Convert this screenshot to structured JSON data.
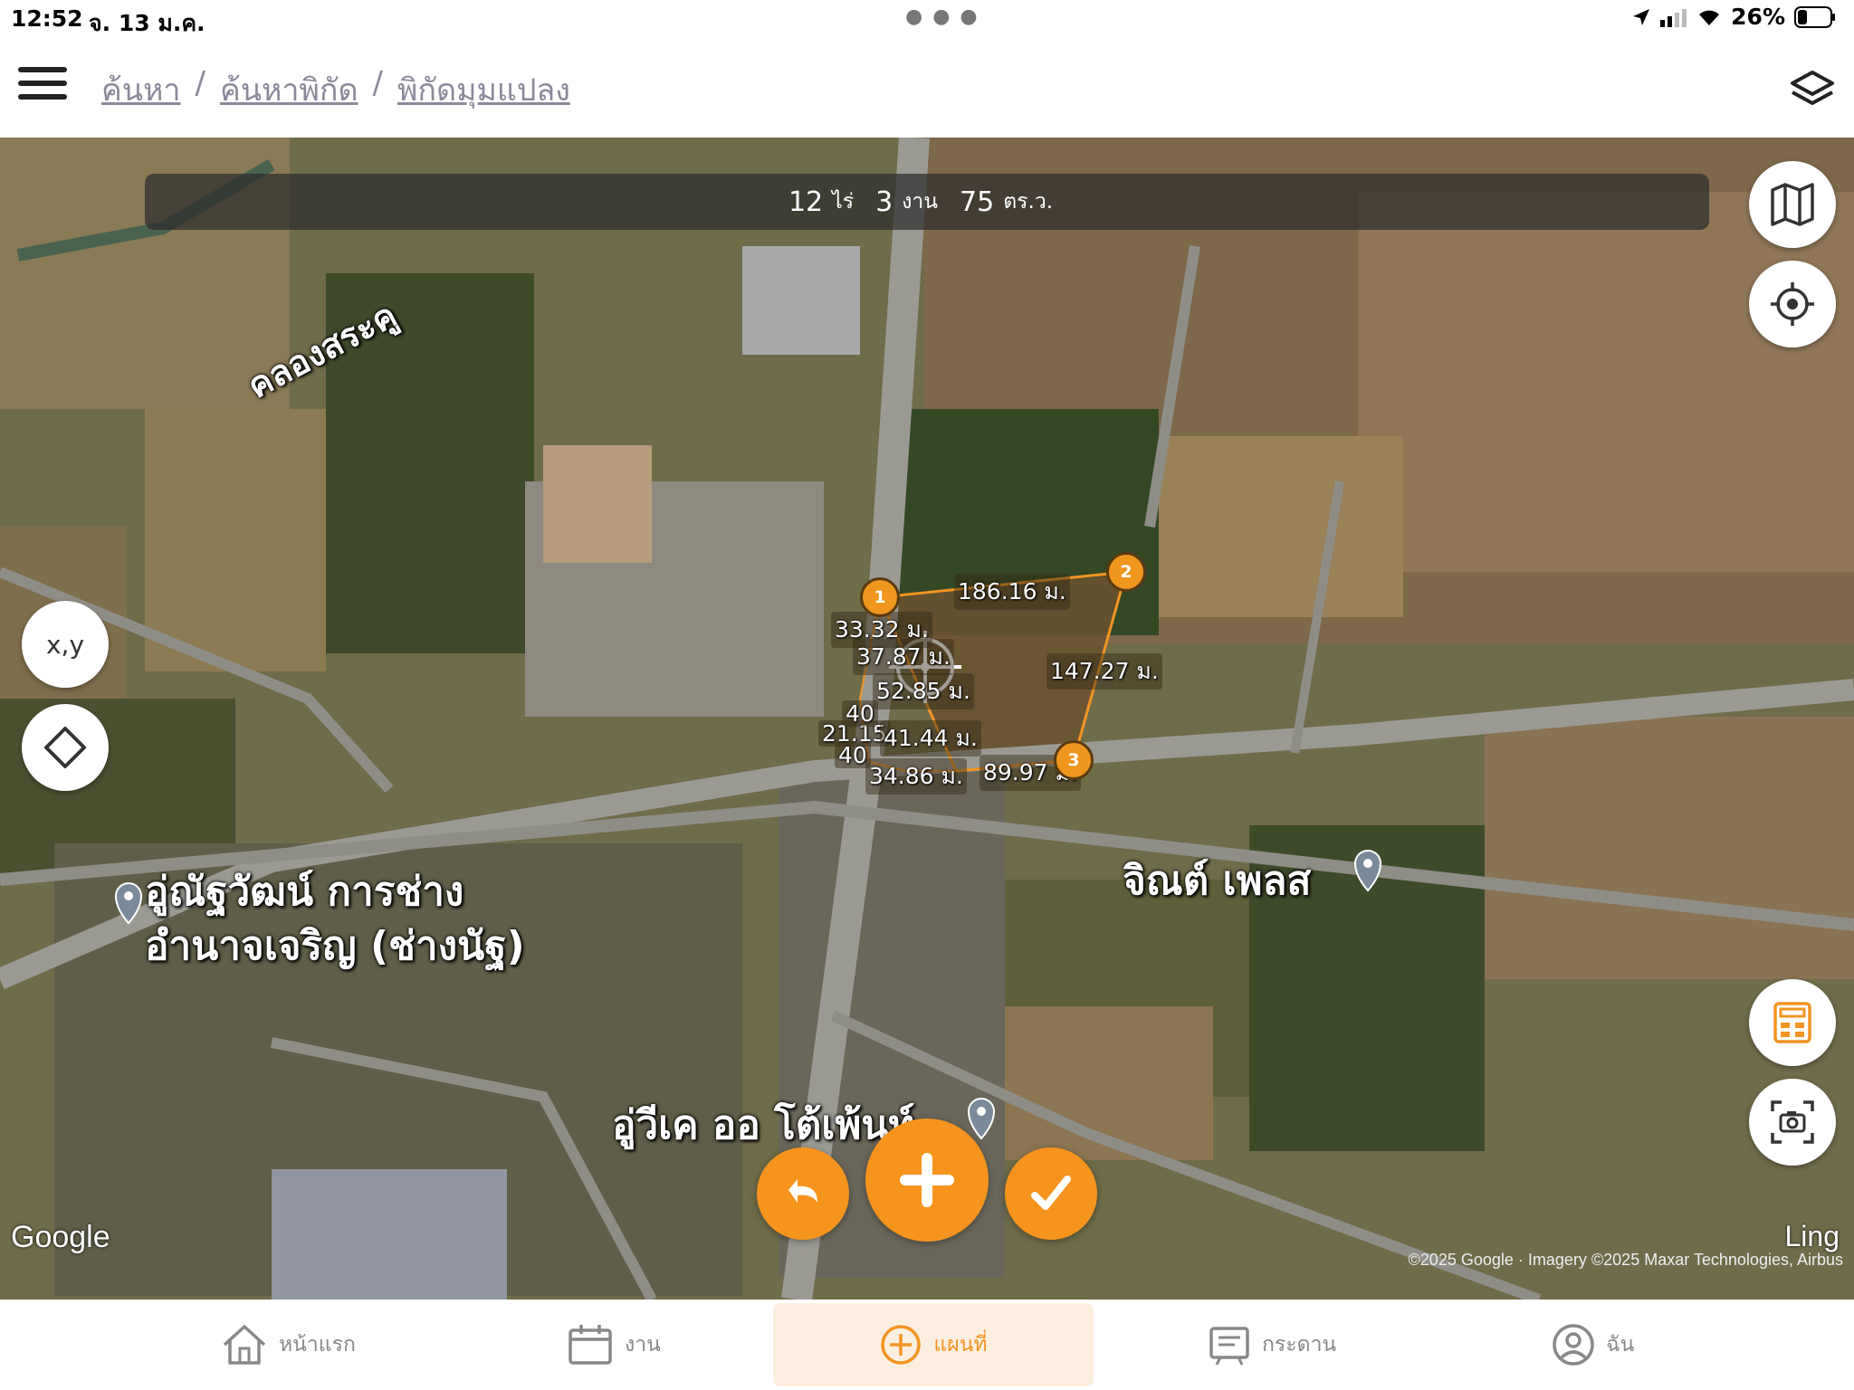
{
  "status_bar": {
    "time": "12:52",
    "date": "จ. 13 ม.ค.",
    "battery": "26%"
  },
  "breadcrumb": [
    "ค้นหา",
    "ค้นหาพิกัด",
    "พิกัดมุมแปลง"
  ],
  "breadcrumb_separator": "/",
  "area": {
    "rai_value": "12",
    "rai_unit": "ไร่",
    "ngan_value": "3",
    "ngan_unit": "งาน",
    "wa_value": "75",
    "wa_unit": "ตร.ว."
  },
  "map_labels": {
    "canal": "คลองสระคู",
    "shop_line1": "อู่ณัฐวัฒน์ การช่าง",
    "shop_line2": "อำนาจเจริญ (ช่างนัฐ)",
    "place_right": "จิณต์ เพลส",
    "garage": "อู่วีเค ออ โต้เพ้นท์"
  },
  "measurements": {
    "seg_1_2": "186.16 ม.",
    "seg_2_3": "147.27 ม.",
    "seg_a": "33.32 ม.",
    "seg_b": "37.87 ม.",
    "seg_c": "52.85 ม.",
    "seg_d": "21.15",
    "seg_e": "41.44 ม.",
    "seg_f": "34.86 ม.",
    "seg_g": "89.97 ม.",
    "overlap_1": "40",
    "overlap_2": "40"
  },
  "vertices": [
    "1",
    "2",
    "3"
  ],
  "map_controls": {
    "xy_label": "x,y"
  },
  "attribution": {
    "google": "Google",
    "brand": "Ling",
    "copyright": "©2025 Google · Imagery ©2025 Maxar Technologies, Airbus"
  },
  "nav": {
    "home": "หน้าแรก",
    "jobs": "งาน",
    "map": "แผนที่",
    "board": "กระดาน",
    "me": "ฉัน"
  },
  "colors": {
    "accent": "#F7941D",
    "nav_active_bg": "#FDEFE0",
    "breadcrumb": "#8A8A9A"
  }
}
